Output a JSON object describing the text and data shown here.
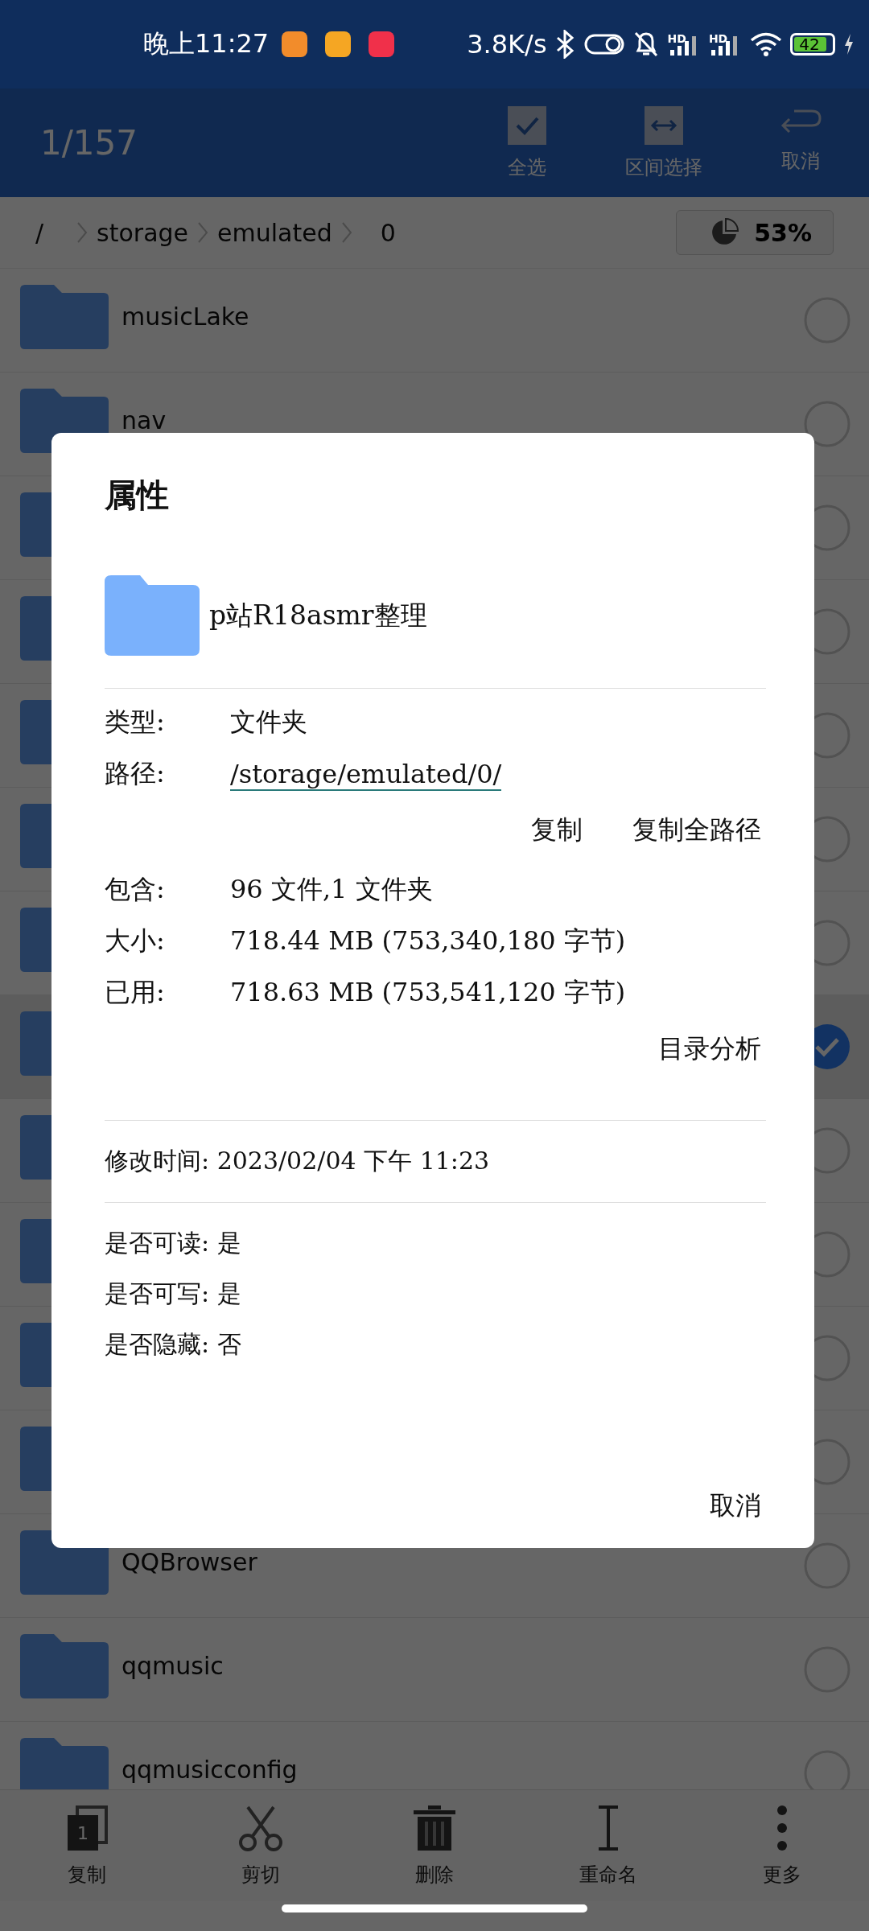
{
  "status_bar": {
    "time": "晚上11:27",
    "network_speed": "3.8K/s",
    "signals": [
      "HD",
      "HD"
    ],
    "battery": "42"
  },
  "top_bar": {
    "counter": "1/157",
    "actions": [
      {
        "kind": "select-all",
        "label": "全选"
      },
      {
        "kind": "range",
        "label": "区间选择"
      },
      {
        "kind": "cancel",
        "label": "取消"
      }
    ]
  },
  "breadcrumb": {
    "parts": [
      "/",
      "storage",
      "emulated",
      "0"
    ],
    "storage": "53%"
  },
  "file_list": [
    {
      "name": "musicLake",
      "selected": false
    },
    {
      "name": "nav",
      "selected": false
    },
    {
      "selected": false
    },
    {
      "selected": false
    },
    {
      "selected": false
    },
    {
      "selected": false
    },
    {
      "selected": false
    },
    {
      "selected": true
    },
    {
      "selected": false
    },
    {
      "selected": false
    },
    {
      "selected": false
    },
    {
      "selected": false
    },
    {
      "name": "QQBrowser",
      "selected": false
    },
    {
      "name": "qqmusic",
      "selected": false
    },
    {
      "name": "qqmusicconfig",
      "selected": false
    }
  ],
  "dialog": {
    "title": "属性",
    "folder_name": "p站R18asmr整理",
    "info": [
      {
        "label": "类型:",
        "value": "文件夹"
      },
      {
        "label": "路径:",
        "value": "/storage/emulated/0/",
        "kind": "link"
      }
    ],
    "copy_actions": [
      "复制",
      "复制全路径"
    ],
    "sizes": [
      {
        "label": "包含:",
        "value": "96 文件,1 文件夹"
      },
      {
        "label": "大小:",
        "value": "718.44 MB (753,340,180 字节)"
      },
      {
        "label": "已用:",
        "value": "718.63 MB (753,541,120 字节)"
      }
    ],
    "analyze": "目录分析",
    "modified": "修改时间: 2023/02/04 下午 11:23",
    "flags": [
      "是否可读: 是",
      "是否可写: 是",
      "是否隐藏: 否"
    ],
    "cancel": "取消"
  },
  "bottom_bar": [
    {
      "kind": "copy",
      "label": "复制",
      "badge": "1"
    },
    {
      "kind": "cut",
      "label": "剪切"
    },
    {
      "kind": "delete",
      "label": "删除"
    },
    {
      "kind": "rename",
      "label": "重命名"
    },
    {
      "kind": "more",
      "label": "更多"
    }
  ]
}
